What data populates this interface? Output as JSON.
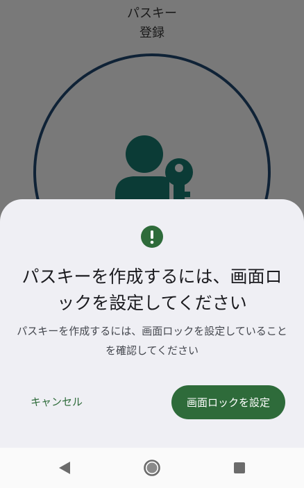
{
  "background": {
    "title_line1": "パスキー",
    "title_line2": "登録"
  },
  "icons": {
    "background_illustration": "person-with-key-icon",
    "alert": "exclamation-circle-icon",
    "nav_back": "back-triangle-icon",
    "nav_home": "home-circle-icon",
    "nav_recents": "recents-square-icon"
  },
  "dialog": {
    "title": "パスキーを作成するには、画面ロックを設定してください",
    "body": "パスキーを作成するには、画面ロックを設定していることを確認してください",
    "cancel_label": "キャンセル",
    "confirm_label": "画面ロックを設定"
  },
  "colors": {
    "accent": "#2e6b3a",
    "sheet_background": "#efeff4",
    "scrim": "#797979",
    "ring": "#0f2236",
    "illustration": "#0b3b36"
  }
}
